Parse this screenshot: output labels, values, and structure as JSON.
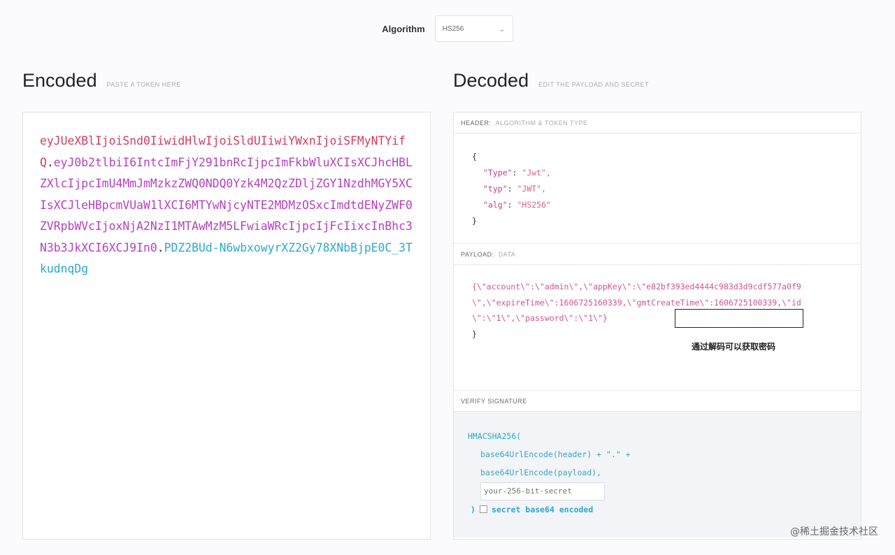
{
  "algorithm": {
    "label": "Algorithm",
    "value": "HS256"
  },
  "encoded": {
    "title": "Encoded",
    "subtitle": "PASTE A TOKEN HERE",
    "header_part": "eyJUeXBlIjoiSnd0IiwidHlwIjoiSldUIiwiYWxnIjoiSFMyNTYifQ",
    "payload_part": "eyJ0b2tlbiI6IntcImFjY291bnRcIjpcImFkbWluXCIsXCJhcHBLZXlcIjpcImU4MmJmMzkzZWQ0NDQ0Yzk4M2QzZDljZGY1NzdhMGY5XCIsXCJleHBpcmVUaW1lXCI6MTYwNjcyNTE2MDMzOSxcImdtdENyZWF0ZVRpbWVcIjoxNjA2NzI1MTAwMzM5LFwiaWRcIjpcIjFcIixcInBhc3N3b3JkXCI6XCJ9In0",
    "signature_part": "PDZ2BUd-N6wbxowyrXZ2Gy78XNbBjpE0C_3TkudnqDg",
    "dot": "."
  },
  "decoded": {
    "title": "Decoded",
    "subtitle": "EDIT THE PAYLOAD AND SECRET",
    "header_section": {
      "label": "HEADER:",
      "sublabel": "ALGORITHM & TOKEN TYPE",
      "open": "{",
      "close": "}",
      "lines": [
        {
          "key": "\"Type\"",
          "value": "\"Jwt\","
        },
        {
          "key": "\"typ\"",
          "value": "\"JWT\","
        },
        {
          "key": "\"alg\"",
          "value": "\"HS256\""
        }
      ]
    },
    "payload_section": {
      "label": "PAYLOAD:",
      "sublabel": "DATA",
      "text": "{\\\"account\\\":\\\"admin\\\",\\\"appKey\\\":\\\"e82bf393ed4444c983d3d9cdf577a0f9\\\",\\\"expireTime\\\":1606725160339,\\\"gmtCreateTime\\\":1606725100339,\\\"id\\\":\\\"1\\\",\\\"password\\\":\\\"1\\\"}",
      "close": "}",
      "annotation": "通过解码可以获取密码"
    },
    "verify_section": {
      "label": "VERIFY SIGNATURE",
      "fn": "HMACSHA256(",
      "arg1": "base64UrlEncode(header) + \".\" +",
      "arg2": "base64UrlEncode(payload),",
      "secret_placeholder": "your-256-bit-secret",
      "close": ")",
      "checkbox_label": "secret base64 encoded"
    }
  },
  "watermark": "@稀土掘金技术社区"
}
